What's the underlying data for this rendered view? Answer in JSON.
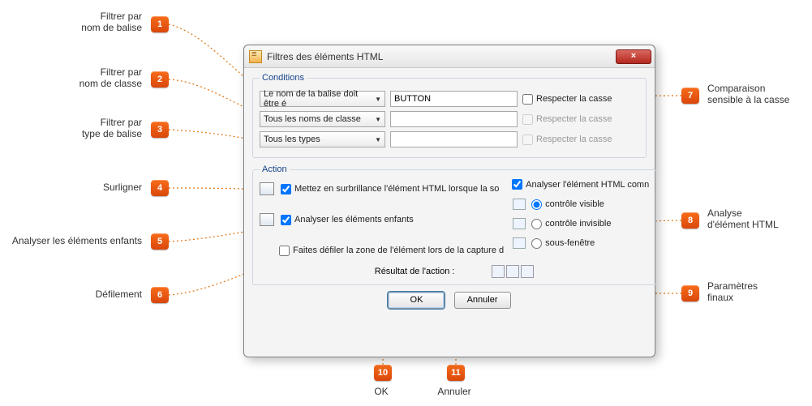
{
  "dialog": {
    "title": "Filtres des éléments HTML",
    "close": "×"
  },
  "conditions": {
    "legend": "Conditions",
    "rows": [
      {
        "combo": "Le nom de la balise doit être é",
        "value": "BUTTON",
        "caseLabel": "Respecter la casse",
        "caseEnabled": true,
        "caseChecked": false
      },
      {
        "combo": "Tous les noms de classe",
        "value": "",
        "caseLabel": "Respecter la casse",
        "caseEnabled": false,
        "caseChecked": false
      },
      {
        "combo": "Tous les types",
        "value": "",
        "caseLabel": "Respecter la casse",
        "caseEnabled": false,
        "caseChecked": false
      }
    ]
  },
  "action": {
    "legend": "Action",
    "highlight": "Mettez en surbrillance l'élément HTML lorsque la so",
    "parseAs": "Analyser l'élément HTML comn",
    "children": "Analyser les éléments enfants",
    "scroll": "Faites défiler la zone de l'élément lors de la capture d",
    "opts": {
      "visible": "contrôle visible",
      "invisible": "contrôle invisible",
      "subwin": "sous-fenêtre"
    },
    "resultLabel": "Résultat de l'action :"
  },
  "buttons": {
    "ok": "OK",
    "cancel": "Annuler"
  },
  "annotations": {
    "a1": "Filtrer par\nnom de balise",
    "a2": "Filtrer par\nnom de classe",
    "a3": "Filtrer par\ntype de balise",
    "a4": "Surligner",
    "a5": "Analyser les éléments enfants",
    "a6": "Défilement",
    "a7": "Comparaison\nsensible à la casse",
    "a8": "Analyse\nd'élément HTML",
    "a9": "Paramètres\nfinaux",
    "a10": "OK",
    "a11": "Annuler"
  }
}
